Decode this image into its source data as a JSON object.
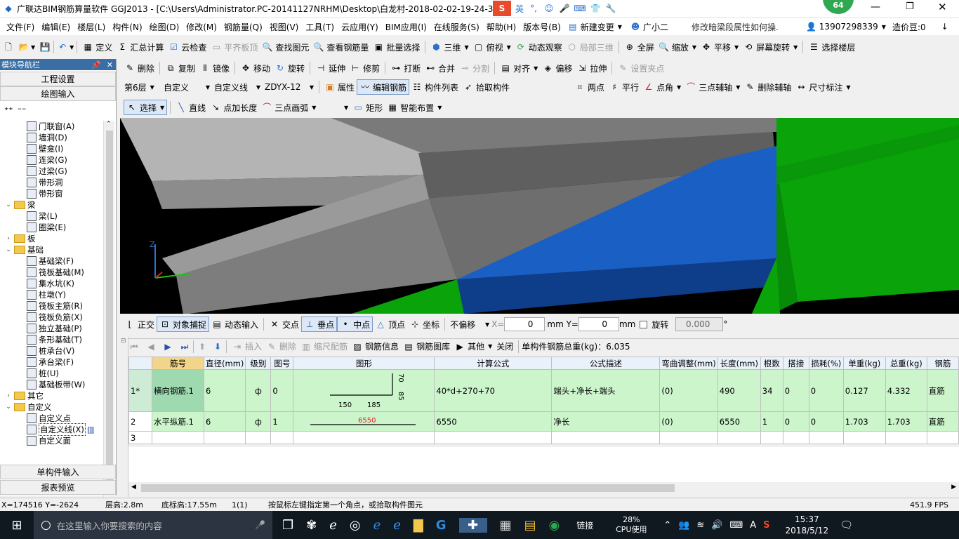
{
  "window": {
    "title": "广联达BIM钢筋算量软件 GGJ2013 - [C:\\Users\\Administrator.PC-20141127NRHM\\Desktop\\白龙村-2018-02-02-19-24-35",
    "notif_count": "64",
    "ime_label": "英"
  },
  "menu": {
    "items": [
      "文件(F)",
      "编辑(E)",
      "楼层(L)",
      "构件(N)",
      "绘图(D)",
      "修改(M)",
      "钢筋量(Q)",
      "视图(V)",
      "工具(T)",
      "云应用(Y)",
      "BIM应用(I)",
      "在线服务(S)",
      "帮助(H)",
      "版本号(B)"
    ],
    "new_change": "新建变更",
    "assistant": "广小二",
    "tip": "修改暗梁段属性如何操.",
    "phone": "13907298339",
    "beans": "造价豆:0"
  },
  "toolbar1": {
    "items": [
      "定义",
      "汇总计算",
      "云检查",
      "平齐板顶",
      "查找图元",
      "查看钢筋量",
      "批量选择",
      "三维",
      "俯视",
      "动态观察",
      "局部三维",
      "全屏",
      "缩放",
      "平移",
      "屏幕旋转",
      "选择楼层"
    ]
  },
  "toolbar2": {
    "items": [
      "删除",
      "复制",
      "镜像",
      "移动",
      "旋转",
      "延伸",
      "修剪",
      "打断",
      "合并",
      "分割",
      "对齐",
      "偏移",
      "拉伸",
      "设置夹点"
    ]
  },
  "toolbar3": {
    "floor": "第6层",
    "type": "自定义",
    "subtype": "自定义线",
    "name": "ZDYX-12",
    "items": [
      "属性",
      "编辑钢筋",
      "构件列表",
      "拾取构件"
    ],
    "axis_items": [
      "两点",
      "平行",
      "点角",
      "三点辅轴",
      "删除辅轴",
      "尺寸标注"
    ]
  },
  "toolbar4": {
    "items": [
      "选择",
      "直线",
      "点加长度",
      "三点画弧",
      "矩形",
      "智能布置"
    ]
  },
  "nav": {
    "title": "模块导航栏",
    "btn_project": "工程设置",
    "btn_draw": "绘图输入",
    "btn_single": "单构件输入",
    "btn_report": "报表预览",
    "tree": [
      {
        "level": 2,
        "label": "门联窗(A)",
        "kind": "item"
      },
      {
        "level": 2,
        "label": "墙洞(D)",
        "kind": "item"
      },
      {
        "level": 2,
        "label": "壁龛(I)",
        "kind": "item"
      },
      {
        "level": 2,
        "label": "连梁(G)",
        "kind": "item"
      },
      {
        "level": 2,
        "label": "过梁(G)",
        "kind": "item"
      },
      {
        "level": 2,
        "label": "带形洞",
        "kind": "item"
      },
      {
        "level": 2,
        "label": "带形窗",
        "kind": "item"
      },
      {
        "level": 1,
        "label": "梁",
        "kind": "folder",
        "exp": "⌄"
      },
      {
        "level": 2,
        "label": "梁(L)",
        "kind": "item"
      },
      {
        "level": 2,
        "label": "圈梁(E)",
        "kind": "item"
      },
      {
        "level": 1,
        "label": "板",
        "kind": "folder",
        "exp": "›"
      },
      {
        "level": 1,
        "label": "基础",
        "kind": "folder",
        "exp": "⌄"
      },
      {
        "level": 2,
        "label": "基础梁(F)",
        "kind": "item"
      },
      {
        "level": 2,
        "label": "筏板基础(M)",
        "kind": "item"
      },
      {
        "level": 2,
        "label": "集水坑(K)",
        "kind": "item"
      },
      {
        "level": 2,
        "label": "柱墩(Y)",
        "kind": "item"
      },
      {
        "level": 2,
        "label": "筏板主筋(R)",
        "kind": "item"
      },
      {
        "level": 2,
        "label": "筏板负筋(X)",
        "kind": "item"
      },
      {
        "level": 2,
        "label": "独立基础(P)",
        "kind": "item"
      },
      {
        "level": 2,
        "label": "条形基础(T)",
        "kind": "item"
      },
      {
        "level": 2,
        "label": "桩承台(V)",
        "kind": "item"
      },
      {
        "level": 2,
        "label": "承台梁(F)",
        "kind": "item"
      },
      {
        "level": 2,
        "label": "桩(U)",
        "kind": "item"
      },
      {
        "level": 2,
        "label": "基础板带(W)",
        "kind": "item"
      },
      {
        "level": 1,
        "label": "其它",
        "kind": "folder",
        "exp": "›"
      },
      {
        "level": 1,
        "label": "自定义",
        "kind": "folder",
        "exp": "⌄"
      },
      {
        "level": 2,
        "label": "自定义点",
        "kind": "item"
      },
      {
        "level": 2,
        "label": "自定义线(X)",
        "kind": "item",
        "selected": true
      },
      {
        "level": 2,
        "label": "自定义面",
        "kind": "item"
      }
    ]
  },
  "snap_bar": {
    "items": [
      "正交",
      "对象捕捉",
      "动态输入",
      "交点",
      "垂点",
      "中点",
      "顶点",
      "坐标"
    ],
    "offset": "不偏移",
    "x_label": "X=",
    "x_value": "0",
    "y_label": "mm Y=",
    "y_value": "0",
    "mm": "mm",
    "rotate_label": "旋转",
    "rotate_value": "0.000",
    "deg": "°"
  },
  "rebar_bar": {
    "items": [
      "插入",
      "删除",
      "缩尺配筋",
      "钢筋信息",
      "钢筋图库",
      "其他",
      "关闭"
    ],
    "total": "单构件钢筋总重(kg)：6.035"
  },
  "grid": {
    "headers": [
      "筋号",
      "直径(mm)",
      "级别",
      "图号",
      "图形",
      "计算公式",
      "公式描述",
      "弯曲调整(mm)",
      "长度(mm)",
      "根数",
      "搭接",
      "损耗(%)",
      "单重(kg)",
      "总重(kg)",
      "钢筋"
    ],
    "rows": [
      {
        "no": "1*",
        "name": "横向钢筋.1",
        "dia": "6",
        "grade": "ф",
        "fig": "0",
        "formula": "40*d+270+70",
        "desc": "端头+净长+端头",
        "bend": "(0)",
        "len": "490",
        "count": "34",
        "lap": "0",
        "loss": "0",
        "unit": "0.127",
        "total": "4.332",
        "type": "直筋",
        "shape": {
          "a": "150",
          "b": "185",
          "c": "85",
          "d": "70"
        }
      },
      {
        "no": "2",
        "name": "水平纵筋.1",
        "dia": "6",
        "grade": "ф",
        "fig": "1",
        "formula": "6550",
        "desc": "净长",
        "bend": "(0)",
        "len": "6550",
        "count": "1",
        "lap": "0",
        "loss": "0",
        "unit": "1.703",
        "total": "1.703",
        "type": "直筋",
        "shape": {
          "a": "6550"
        }
      },
      {
        "no": "3"
      }
    ]
  },
  "status": {
    "coords": "X=174516 Y=-2624",
    "floor_height": "层高:2.8m",
    "base_height": "底标高:17.55m",
    "count": "1(1)",
    "hint": "按鼠标左键指定第一个角点，或拾取构件图元",
    "fps": "451.9 FPS"
  },
  "taskbar": {
    "search_placeholder": "在这里输入你要搜索的内容",
    "link": "链接",
    "cpu_pct": "28%",
    "cpu_label": "CPU使用",
    "ime": "A",
    "time": "15:37",
    "date": "2018/5/12"
  },
  "axis": {
    "z": "Z"
  }
}
